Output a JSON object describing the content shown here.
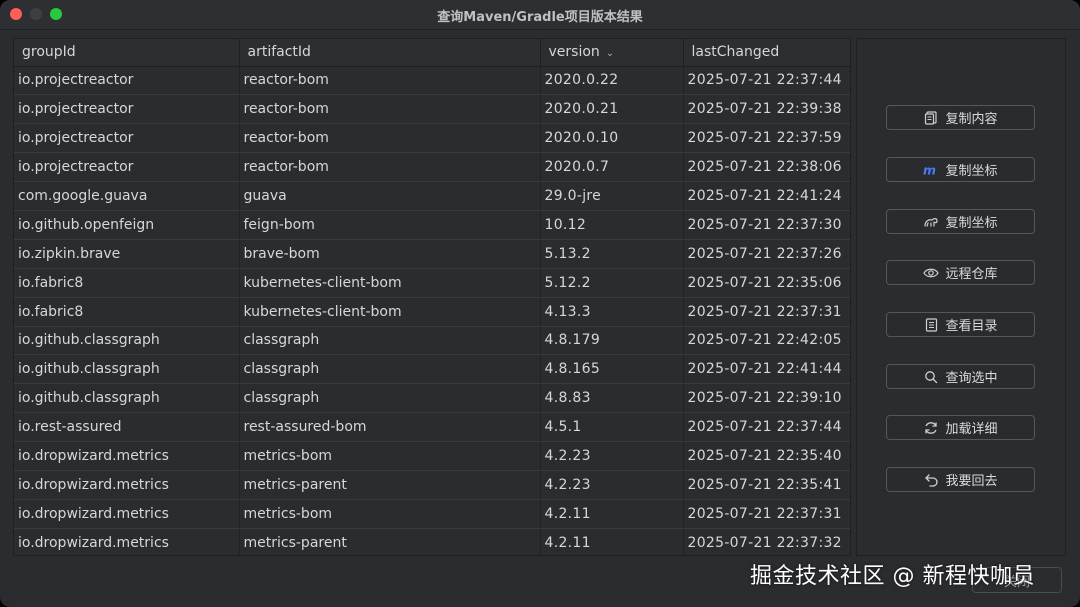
{
  "window": {
    "title": "查询Maven/Gradle项目版本结果"
  },
  "table": {
    "columns": [
      "groupId",
      "artifactId",
      "version",
      "lastChanged"
    ],
    "sort_column": "version",
    "rows": [
      [
        "io.projectreactor",
        "reactor-bom",
        "2020.0.22",
        "2025-07-21 22:37:44"
      ],
      [
        "io.projectreactor",
        "reactor-bom",
        "2020.0.21",
        "2025-07-21 22:39:38"
      ],
      [
        "io.projectreactor",
        "reactor-bom",
        "2020.0.10",
        "2025-07-21 22:37:59"
      ],
      [
        "io.projectreactor",
        "reactor-bom",
        "2020.0.7",
        "2025-07-21 22:38:06"
      ],
      [
        "com.google.guava",
        "guava",
        "29.0-jre",
        "2025-07-21 22:41:24"
      ],
      [
        "io.github.openfeign",
        "feign-bom",
        "10.12",
        "2025-07-21 22:37:30"
      ],
      [
        "io.zipkin.brave",
        "brave-bom",
        "5.13.2",
        "2025-07-21 22:37:26"
      ],
      [
        "io.fabric8",
        "kubernetes-client-bom",
        "5.12.2",
        "2025-07-21 22:35:06"
      ],
      [
        "io.fabric8",
        "kubernetes-client-bom",
        "4.13.3",
        "2025-07-21 22:37:31"
      ],
      [
        "io.github.classgraph",
        "classgraph",
        "4.8.179",
        "2025-07-21 22:42:05"
      ],
      [
        "io.github.classgraph",
        "classgraph",
        "4.8.165",
        "2025-07-21 22:41:44"
      ],
      [
        "io.github.classgraph",
        "classgraph",
        "4.8.83",
        "2025-07-21 22:39:10"
      ],
      [
        "io.rest-assured",
        "rest-assured-bom",
        "4.5.1",
        "2025-07-21 22:37:44"
      ],
      [
        "io.dropwizard.metrics",
        "metrics-bom",
        "4.2.23",
        "2025-07-21 22:35:40"
      ],
      [
        "io.dropwizard.metrics",
        "metrics-parent",
        "4.2.23",
        "2025-07-21 22:35:41"
      ],
      [
        "io.dropwizard.metrics",
        "metrics-bom",
        "4.2.11",
        "2025-07-21 22:37:31"
      ],
      [
        "io.dropwizard.metrics",
        "metrics-parent",
        "4.2.11",
        "2025-07-21 22:37:32"
      ]
    ]
  },
  "actions": [
    {
      "label": "复制内容",
      "icon": "copy-icon"
    },
    {
      "label": "复制坐标",
      "icon": "maven-icon"
    },
    {
      "label": "复制坐标",
      "icon": "gradle-icon"
    },
    {
      "label": "远程仓库",
      "icon": "eye-icon"
    },
    {
      "label": "查看目录",
      "icon": "document-icon"
    },
    {
      "label": "查询选中",
      "icon": "search-icon"
    },
    {
      "label": "加载详细",
      "icon": "refresh-icon"
    },
    {
      "label": "我要回去",
      "icon": "undo-icon"
    }
  ],
  "footer": {
    "ok_label": "关闭"
  },
  "watermark": "掘金技术社区 @ 新程快咖员",
  "colors": {
    "background": "#2b2c2f",
    "text": "#d6d7d9",
    "accent": "#4a7cf7"
  }
}
